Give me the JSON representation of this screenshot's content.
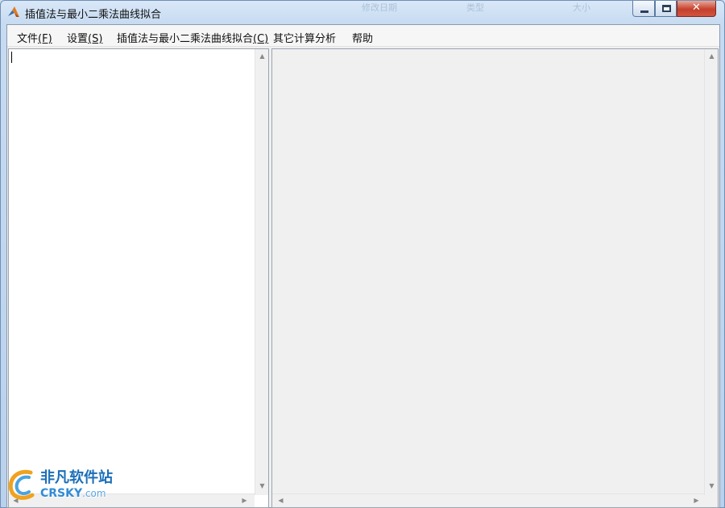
{
  "window": {
    "title": "插值法与最小二乘法曲线拟合",
    "background_ghost": [
      "修改日期",
      "类型",
      "大小"
    ],
    "controls": {
      "minimize": "minimize",
      "maximize": "maximize",
      "close": "✕"
    }
  },
  "menu": {
    "items": [
      {
        "label": "文件",
        "mnemonic": "(F)"
      },
      {
        "label": "设置",
        "mnemonic": "(S)"
      },
      {
        "label": "插值法与最小二乘法曲线拟合",
        "mnemonic": "(C)"
      },
      {
        "label": "其它计算分析",
        "mnemonic": ""
      },
      {
        "label": "帮助",
        "mnemonic": ""
      }
    ]
  },
  "left_pane": {
    "text": ""
  },
  "right_pane": {
    "content": ""
  },
  "scroll_arrows": {
    "up": "▲",
    "down": "▼",
    "left": "◀",
    "right": "▶"
  },
  "watermark": {
    "cn": "非凡软件站",
    "en": "CRSKY",
    "domain": ".com"
  },
  "colors": {
    "accent": "#1c6fb8",
    "close": "#c5402c"
  }
}
